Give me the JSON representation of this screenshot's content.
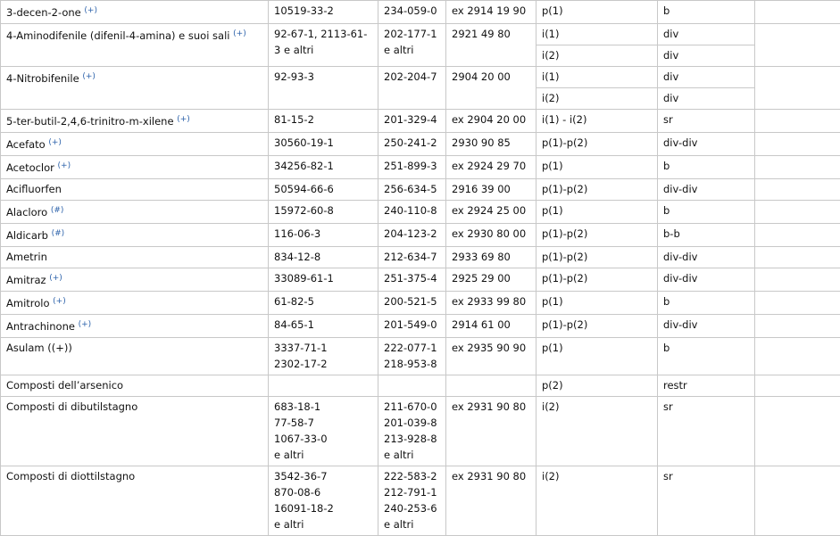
{
  "rows": [
    {
      "name": "3-decen-2-one",
      "note": "(+)",
      "cas": [
        "10519-33-2"
      ],
      "ec": [
        "234-059-0"
      ],
      "cn": "ex 2914 19 90",
      "cat": [
        "p(1)"
      ],
      "use": [
        "b"
      ],
      "extra": ""
    },
    {
      "name": "4-Aminodifenile (difenil-4-amina) e suoi sali",
      "note": "(+)",
      "cas": [
        "92-67-1,  2113-61-3 e altri"
      ],
      "ec": [
        "202-177-1 e altri"
      ],
      "cn": "2921 49 80",
      "cat": [
        "i(1)",
        "i(2)"
      ],
      "use": [
        "div",
        "div"
      ],
      "extra": ""
    },
    {
      "name": "4-Nitrobifenile",
      "note": "(+)",
      "cas": [
        "92-93-3"
      ],
      "ec": [
        "202-204-7"
      ],
      "cn": "2904 20 00",
      "cat": [
        "i(1)",
        "i(2)"
      ],
      "use": [
        "div",
        "div"
      ],
      "extra": ""
    },
    {
      "name": "5-ter-butil-2,4,6-trinitro-m-xilene",
      "note": "(+)",
      "cas": [
        "81-15-2"
      ],
      "ec": [
        "201-329-4"
      ],
      "cn": "ex 2904 20 00",
      "cat": [
        "i(1) - i(2)"
      ],
      "use": [
        "sr"
      ],
      "extra": ""
    },
    {
      "name": "Acefato",
      "note": "(+)",
      "cas": [
        "30560-19-1"
      ],
      "ec": [
        "250-241-2"
      ],
      "cn": "2930 90 85",
      "cat": [
        "p(1)-p(2)"
      ],
      "use": [
        "div-div"
      ],
      "extra": ""
    },
    {
      "name": "Acetoclor",
      "note": "(+)",
      "cas": [
        "34256-82-1"
      ],
      "ec": [
        "251-899-3"
      ],
      "cn": "ex 2924 29 70",
      "cat": [
        "p(1)"
      ],
      "use": [
        "b"
      ],
      "extra": ""
    },
    {
      "name": "Acifluorfen",
      "note": "",
      "cas": [
        "50594-66-6"
      ],
      "ec": [
        "256-634-5"
      ],
      "cn": "2916 39 00",
      "cat": [
        "p(1)-p(2)"
      ],
      "use": [
        "div-div"
      ],
      "extra": ""
    },
    {
      "name": "Alacloro",
      "note": "(#)",
      "cas": [
        "15972-60-8"
      ],
      "ec": [
        "240-110-8"
      ],
      "cn": "ex 2924 25 00",
      "cat": [
        "p(1)"
      ],
      "use": [
        "b"
      ],
      "extra": ""
    },
    {
      "name": "Aldicarb",
      "note": "(#)",
      "cas": [
        "116-06-3"
      ],
      "ec": [
        "204-123-2"
      ],
      "cn": "ex 2930 80 00",
      "cat": [
        "p(1)-p(2)"
      ],
      "use": [
        "b-b"
      ],
      "extra": ""
    },
    {
      "name": "Ametrin",
      "note": "",
      "cas": [
        "834-12-8"
      ],
      "ec": [
        "212-634-7"
      ],
      "cn": "2933 69 80",
      "cat": [
        "p(1)-p(2)"
      ],
      "use": [
        "div-div"
      ],
      "extra": ""
    },
    {
      "name": "Amitraz",
      "note": "(+)",
      "cas": [
        "33089-61-1"
      ],
      "ec": [
        "251-375-4"
      ],
      "cn": "2925 29 00",
      "cat": [
        "p(1)-p(2)"
      ],
      "use": [
        "div-div"
      ],
      "extra": ""
    },
    {
      "name": "Amitrolo",
      "note": "(+)",
      "cas": [
        "61-82-5"
      ],
      "ec": [
        "200-521-5"
      ],
      "cn": "ex 2933 99 80",
      "cat": [
        "p(1)"
      ],
      "use": [
        "b"
      ],
      "extra": ""
    },
    {
      "name": "Antrachinone",
      "note": "(+)",
      "cas": [
        "84-65-1"
      ],
      "ec": [
        "201-549-0"
      ],
      "cn": "2914 61 00",
      "cat": [
        "p(1)-p(2)"
      ],
      "use": [
        "div-div"
      ],
      "extra": ""
    },
    {
      "name": "Asulam ((+))",
      "note": "",
      "cas": [
        "3337-71-1",
        "2302-17-2"
      ],
      "ec": [
        "222-077-1",
        "218-953-8"
      ],
      "cn": "ex 2935 90 90",
      "cat": [
        "p(1)"
      ],
      "use": [
        "b"
      ],
      "extra": ""
    },
    {
      "name": "Composti dell’arsenico",
      "note": "",
      "cas": [
        ""
      ],
      "ec": [
        ""
      ],
      "cn": "",
      "cat": [
        "p(2)"
      ],
      "use": [
        "restr"
      ],
      "extra": ""
    },
    {
      "name": "Composti di dibutilstagno",
      "note": "",
      "cas": [
        "683-18-1",
        "77-58-7",
        "1067-33-0",
        "e altri"
      ],
      "ec": [
        "211-670-0",
        "201-039-8",
        "213-928-8",
        "e altri"
      ],
      "cn": "ex 2931 90 80",
      "cat": [
        "i(2)"
      ],
      "use": [
        "sr"
      ],
      "extra": ""
    },
    {
      "name": "Composti di diottilstagno",
      "note": "",
      "cas": [
        "3542-36-7",
        "870-08-6",
        "16091-18-2",
        "e altri"
      ],
      "ec": [
        "222-583-2",
        "212-791-1",
        "240-253-6",
        "e altri"
      ],
      "cn": "ex 2931 90 80",
      "cat": [
        "i(2)"
      ],
      "use": [
        "sr"
      ],
      "extra": ""
    }
  ]
}
